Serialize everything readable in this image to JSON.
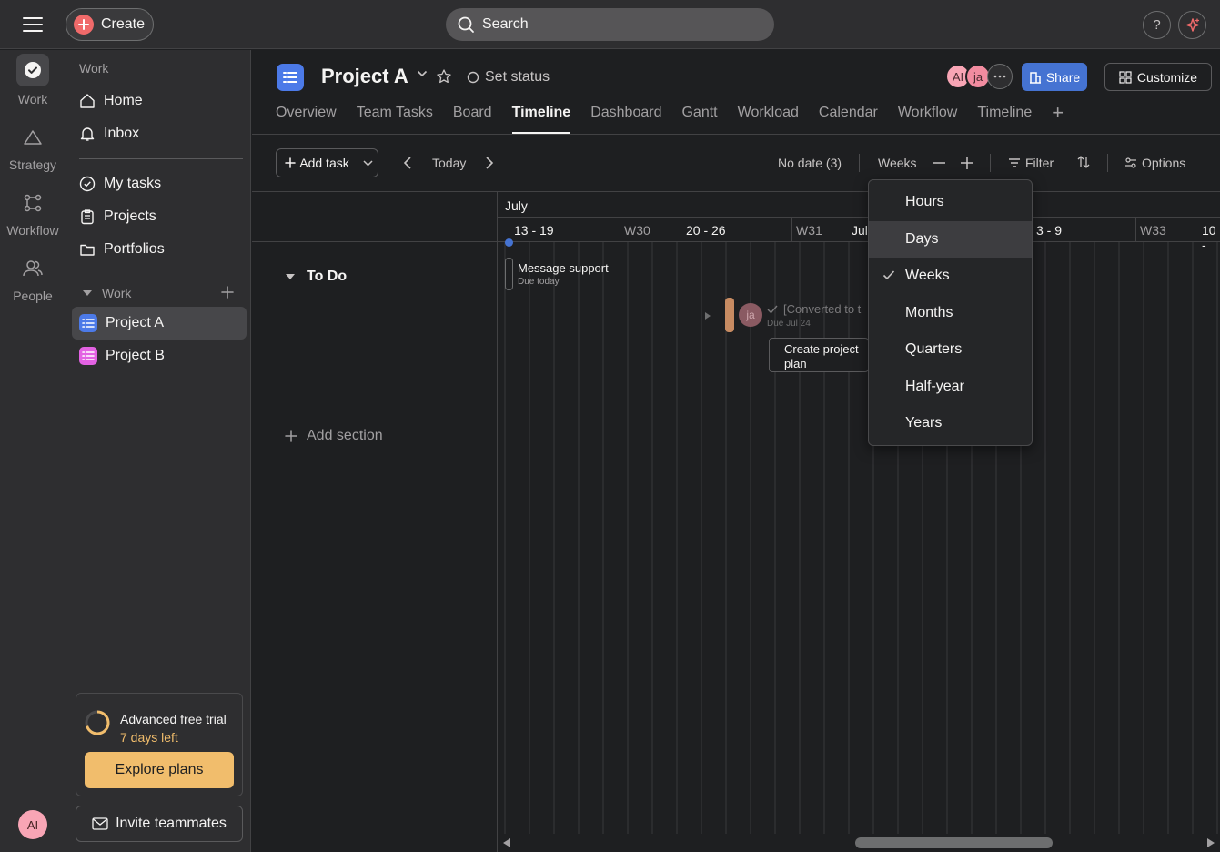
{
  "topbar": {
    "create_label": "Create",
    "search_placeholder": "Search",
    "help_label": "?"
  },
  "rail": {
    "items": [
      {
        "label": "Work",
        "icon": "check-circle-icon"
      },
      {
        "label": "Strategy",
        "icon": "triangle-icon"
      },
      {
        "label": "Workflow",
        "icon": "workflow-icon"
      },
      {
        "label": "People",
        "icon": "people-icon"
      }
    ],
    "user_initials": "AI"
  },
  "sidebar": {
    "heading": "Work",
    "nav": [
      {
        "label": "Home",
        "icon": "home-icon"
      },
      {
        "label": "Inbox",
        "icon": "bell-icon"
      }
    ],
    "nav2": [
      {
        "label": "My tasks",
        "icon": "check-circle-icon"
      },
      {
        "label": "Projects",
        "icon": "clipboard-icon"
      },
      {
        "label": "Portfolios",
        "icon": "folder-icon"
      }
    ],
    "work_section_label": "Work",
    "projects": [
      {
        "label": "Project A",
        "color": "#4c7ae8",
        "active": true
      },
      {
        "label": "Project B",
        "color": "#e362e3",
        "active": false
      }
    ],
    "trial": {
      "title": "Advanced free trial",
      "days_left": "7 days left",
      "explore_label": "Explore plans"
    },
    "invite_label": "Invite teammates"
  },
  "header": {
    "project_title": "Project A",
    "set_status_label": "Set status",
    "members": [
      {
        "initials": "AI",
        "color": "#f8a5b5"
      },
      {
        "initials": "ja",
        "color": "#f28ca0"
      }
    ],
    "share_label": "Share",
    "customize_label": "Customize",
    "tabs": [
      {
        "label": "Overview",
        "active": false
      },
      {
        "label": "Team Tasks",
        "active": false
      },
      {
        "label": "Board",
        "active": false
      },
      {
        "label": "Timeline",
        "active": true
      },
      {
        "label": "Dashboard",
        "active": false
      },
      {
        "label": "Gantt",
        "active": false
      },
      {
        "label": "Workload",
        "active": false
      },
      {
        "label": "Calendar",
        "active": false
      },
      {
        "label": "Workflow",
        "active": false
      },
      {
        "label": "Timeline",
        "active": false
      }
    ]
  },
  "toolbar": {
    "add_task_label": "Add task",
    "today_label": "Today",
    "no_date_label": "No date (3)",
    "zoom_label": "Weeks",
    "filter_label": "Filter",
    "options_label": "Options"
  },
  "list": {
    "section_label": "To Do",
    "add_section_label": "Add section"
  },
  "timeline": {
    "month": "July",
    "weeks": [
      {
        "label": "13 - 19",
        "dim": false
      },
      {
        "label": "W30",
        "dim": true
      },
      {
        "label": "20 - 26",
        "dim": false
      },
      {
        "label": "W31",
        "dim": true
      },
      {
        "label": "Jul",
        "dim": false
      },
      {
        "label": "3 - 9",
        "dim": false
      },
      {
        "label": "W33",
        "dim": true
      },
      {
        "label": "10 -",
        "dim": false
      }
    ],
    "tasks": [
      {
        "title": "Message support",
        "due": "Due today"
      },
      {
        "title": "[Converted to t",
        "due": "Due Jul 24",
        "assignee": "ja"
      },
      {
        "title": "Create project plan"
      }
    ]
  },
  "zoom_menu": {
    "items": [
      {
        "label": "Hours",
        "checked": false,
        "hover": false
      },
      {
        "label": "Days",
        "checked": false,
        "hover": true
      },
      {
        "label": "Weeks",
        "checked": true,
        "hover": false
      },
      {
        "label": "Months",
        "checked": false,
        "hover": false
      },
      {
        "label": "Quarters",
        "checked": false,
        "hover": false
      },
      {
        "label": "Half-year",
        "checked": false,
        "hover": false
      },
      {
        "label": "Years",
        "checked": false,
        "hover": false
      }
    ]
  }
}
